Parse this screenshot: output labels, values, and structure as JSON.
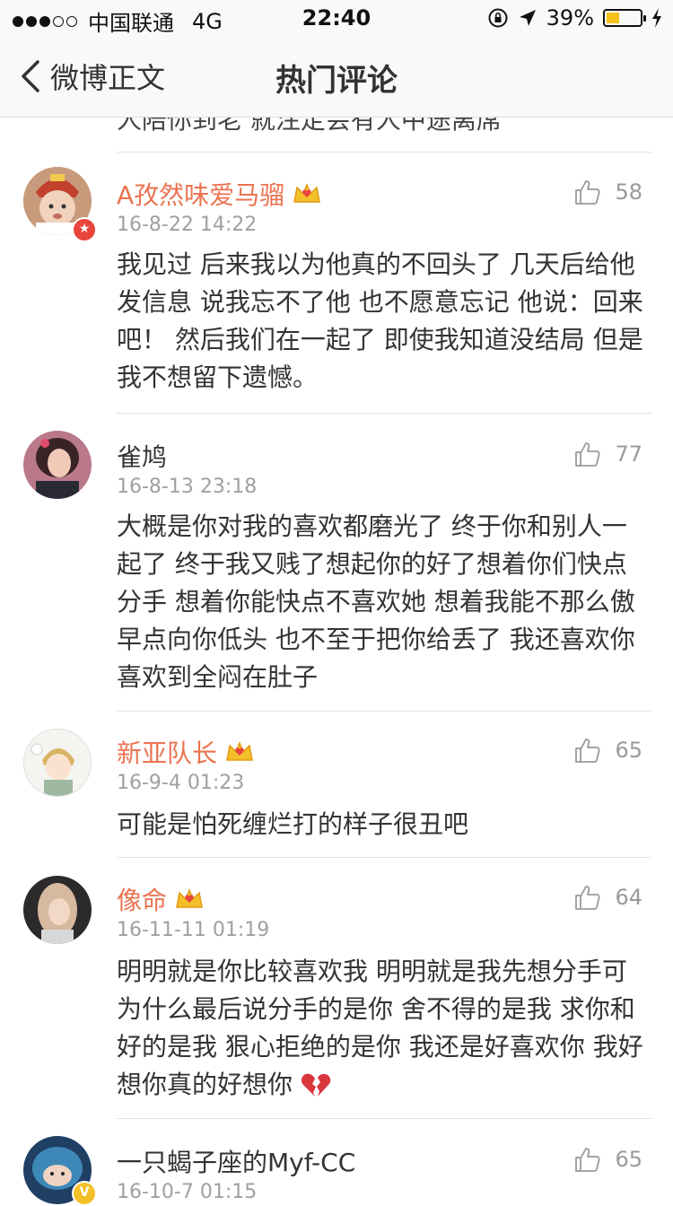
{
  "status_bar": {
    "carrier": "中国联通",
    "network": "4G",
    "time": "22:40",
    "battery_percent": "39%",
    "battery_level": 0.39,
    "signal_dots_filled": 3,
    "signal_dots_total": 5
  },
  "navbar": {
    "back_label": "微博正文",
    "title": "热门评论"
  },
  "cut_off_text": "人陪你到老 就注定会有人中途离席",
  "colors": {
    "vip_name": "#eb7350",
    "meta_gray": "#a0a0a0",
    "crown": "#f4c02a"
  },
  "comments": [
    {
      "name": "A孜然味爱马骝",
      "vip": true,
      "time": "16-8-22 14:22",
      "likes": "58",
      "text": "我见过 后来我以为他真的不回头了 几天后给他发信息 说我忘不了他 也不愿意忘记 他说：回来吧！ 然后我们在一起了 即使我知道没结局 但是我不想留下遗憾。",
      "avatar_icon": "baby-avatar",
      "badge_icon": "verified-badge-red"
    },
    {
      "name": "雀鸠",
      "vip": false,
      "time": "16-8-13 23:18",
      "likes": "77",
      "text": "大概是你对我的喜欢都磨光了 终于你和别人一起了 终于我又贱了想起你的好了想着你们快点分手 想着你能快点不喜欢她 想着我能不那么傲早点向你低头 也不至于把你给丢了 我还喜欢你 喜欢到全闷在肚子",
      "avatar_icon": "girl-avatar"
    },
    {
      "name": "新亚队长",
      "vip": true,
      "time": "16-9-4 01:23",
      "likes": "65",
      "text": "可能是怕死缠烂打的样子很丑吧",
      "avatar_icon": "anime-avatar"
    },
    {
      "name": "像命",
      "vip": true,
      "time": "16-11-11 01:19",
      "likes": "64",
      "text": "明明就是你比较喜欢我 明明就是我先想分手可为什么最后说分手的是你 舍不得的是我 求你和好的是我 狠心拒绝的是你 我还是好喜欢你 我好想你真的好想你",
      "emoji_icon": "broken-heart-icon",
      "avatar_icon": "blonde-avatar"
    },
    {
      "name": "一只蝎子座的Myf-CC",
      "vip": false,
      "time": "16-10-7 01:15",
      "likes": "65",
      "text": "",
      "avatar_icon": "helmet-avatar",
      "badge_icon": "verified-badge-yellow"
    }
  ]
}
